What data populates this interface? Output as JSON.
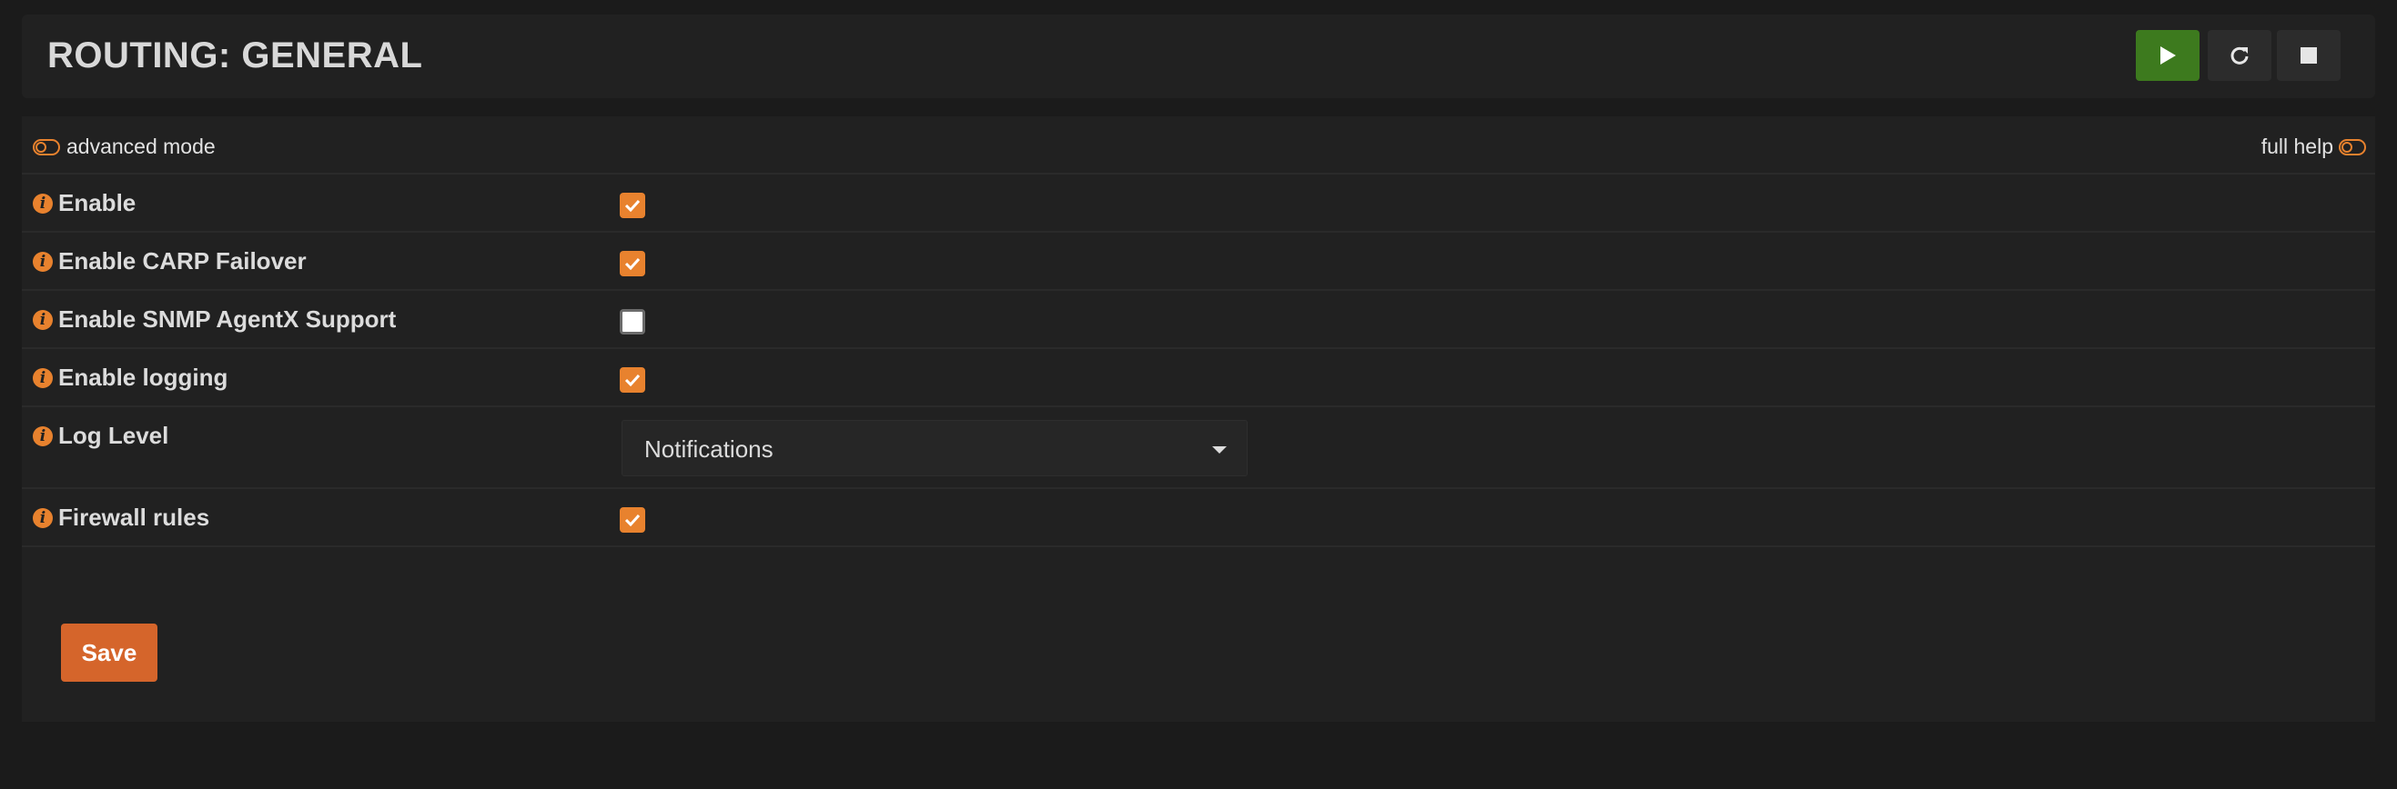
{
  "header": {
    "title": "ROUTING: GENERAL",
    "colors": {
      "start": "#3d7a1e",
      "control": "#2c2c2c"
    },
    "icons": [
      "play-icon",
      "refresh-icon",
      "stop-icon"
    ]
  },
  "toolbar": {
    "advanced_mode_label": "advanced mode",
    "full_help_label": "full help"
  },
  "settings": {
    "enable": {
      "label": "Enable",
      "checked": true
    },
    "carp": {
      "label": "Enable CARP Failover",
      "checked": true
    },
    "snmp": {
      "label": "Enable SNMP AgentX Support",
      "checked": false
    },
    "logging": {
      "label": "Enable logging",
      "checked": true
    },
    "log_level": {
      "label": "Log Level",
      "value": "Notifications"
    },
    "firewall": {
      "label": "Firewall rules",
      "checked": true
    }
  },
  "actions": {
    "save_label": "Save"
  },
  "colors": {
    "accent": "#e8822e",
    "save": "#d5652b",
    "background": "#1b1b1b",
    "panel": "#212121"
  }
}
